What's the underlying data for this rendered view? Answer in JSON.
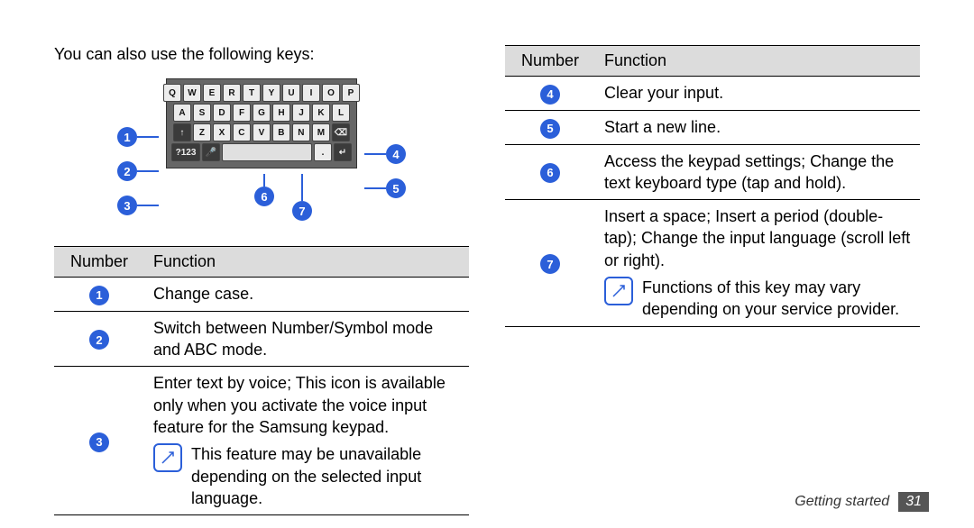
{
  "intro": "You can also use the following keys:",
  "keypad": {
    "rows": [
      [
        "Q",
        "W",
        "E",
        "R",
        "T",
        "Y",
        "U",
        "I",
        "O",
        "P"
      ],
      [
        "A",
        "S",
        "D",
        "F",
        "G",
        "H",
        "J",
        "K",
        "L"
      ]
    ],
    "row3": {
      "shift": "↑",
      "letters": [
        "Z",
        "X",
        "C",
        "V",
        "B",
        "N",
        "M"
      ],
      "back": "⌫"
    },
    "row4": {
      "mode": "?123",
      "mic": "🎤",
      "space": " ",
      "period": ".",
      "enter": "↵"
    }
  },
  "left_callouts": [
    "1",
    "2",
    "3"
  ],
  "right_callouts": [
    "4",
    "5",
    "6",
    "7"
  ],
  "table_headers": {
    "number": "Number",
    "function": "Function"
  },
  "table_left": [
    {
      "num": "1",
      "text": "Change case."
    },
    {
      "num": "2",
      "text": "Switch between Number/Symbol mode and ABC mode."
    },
    {
      "num": "3",
      "text": "Enter text by voice; This icon is available only when you activate the voice input feature for the Samsung keypad.",
      "note": "This feature may be unavailable depending on the selected input language."
    }
  ],
  "table_right": [
    {
      "num": "4",
      "text": "Clear your input."
    },
    {
      "num": "5",
      "text": "Start a new line."
    },
    {
      "num": "6",
      "text": "Access the keypad settings; Change the text keyboard type (tap and hold)."
    },
    {
      "num": "7",
      "text": "Insert a space; Insert a period (double-tap); Change the input language (scroll left or right).",
      "note": "Functions of this key may vary depending on your service provider."
    }
  ],
  "footer": {
    "section": "Getting started",
    "page": "31"
  }
}
